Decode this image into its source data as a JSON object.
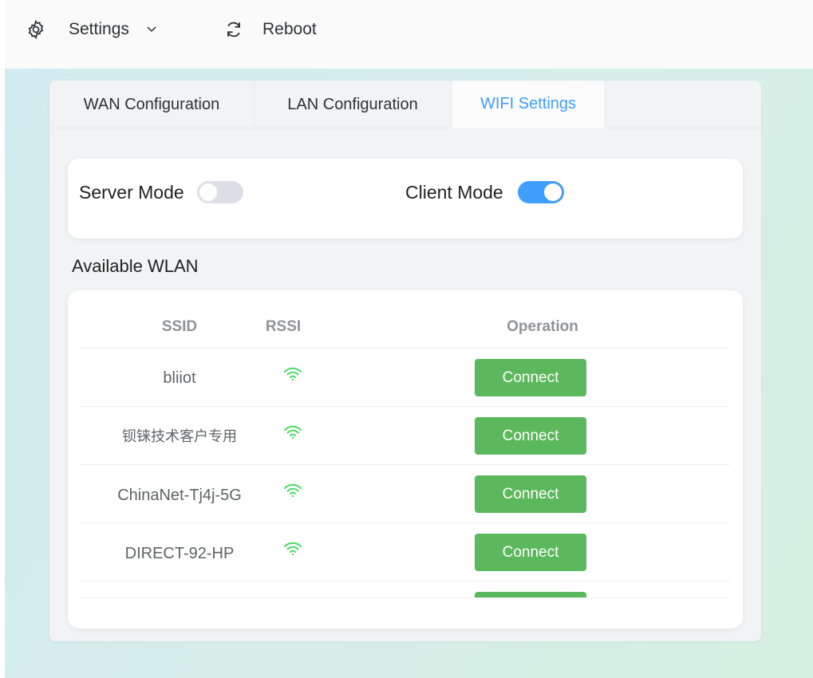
{
  "topbar": {
    "settings_label": "Settings",
    "reboot_label": "Reboot"
  },
  "tabs": [
    {
      "label": "WAN Configuration",
      "active": false
    },
    {
      "label": "LAN Configuration",
      "active": false
    },
    {
      "label": "WIFI Settings",
      "active": true
    }
  ],
  "modes": {
    "server_label": "Server Mode",
    "server_on": false,
    "client_label": "Client Mode",
    "client_on": true
  },
  "wlan": {
    "title": "Available WLAN",
    "columns": {
      "ssid": "SSID",
      "rssi": "RSSI",
      "operation": "Operation"
    },
    "rows": [
      {
        "ssid": "bliiot",
        "rssi_icon": "wifi-signal-icon",
        "button": "Connect"
      },
      {
        "ssid": "钡铼技术客户专用",
        "rssi_icon": "wifi-signal-icon",
        "button": "Connect"
      },
      {
        "ssid": "ChinaNet-Tj4j-5G",
        "rssi_icon": "wifi-signal-icon",
        "button": "Connect"
      },
      {
        "ssid": "DIRECT-92-HP",
        "rssi_icon": "wifi-signal-icon",
        "button": "Connect"
      },
      {
        "ssid": "",
        "rssi_icon": "",
        "button": ""
      }
    ]
  },
  "colors": {
    "accent": "#409eff",
    "connect": "#5cb85c",
    "wifi": "#4cd964"
  }
}
